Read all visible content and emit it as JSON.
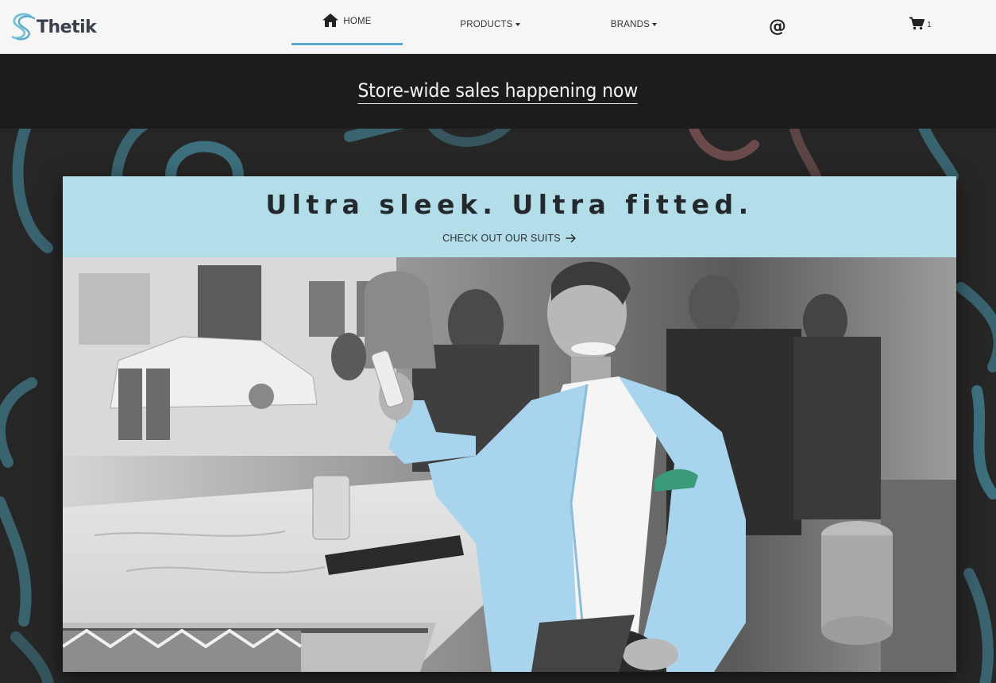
{
  "header": {
    "brand": {
      "name": "Thetik",
      "icon": "thetik-logo-icon"
    },
    "nav": {
      "home": {
        "label": "HOME",
        "icon": "home-icon",
        "active": true
      },
      "products": {
        "label": "PRODUCTS",
        "icon": "caret-down-icon"
      },
      "brands": {
        "label": "BRANDS",
        "icon": "caret-down-icon"
      },
      "contact": {
        "label": "@"
      },
      "cart": {
        "icon": "cart-icon",
        "count": "1"
      }
    }
  },
  "banner": {
    "text": "Store-wide sales happening now"
  },
  "hero": {
    "title": "Ultra sleek. Ultra fitted.",
    "cta": {
      "label": "CHECK OUT OUR SUITS",
      "icon": "arrow-right-icon"
    },
    "image": {
      "subject": "man-in-light-blue-suit-at-cafe-counter"
    }
  },
  "colors": {
    "accent": "#5aa9cf",
    "hero_header_bg": "#b2dde9",
    "navbar_bg": "#f6f6f6",
    "banner_bg": "#1c1c1c",
    "jacket": "#a8d4ee",
    "pattern_stroke": "#3d6f7d",
    "pattern_stroke_alt": "#6a4a4a"
  }
}
